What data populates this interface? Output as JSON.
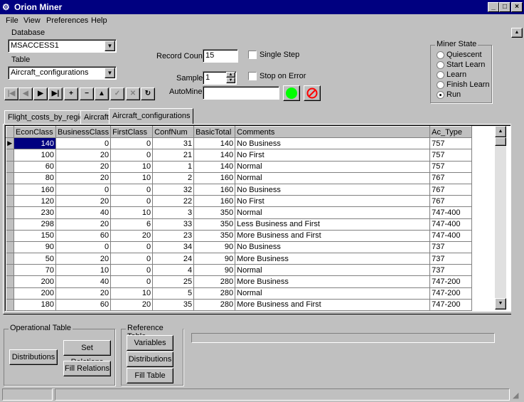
{
  "window": {
    "title": "Orion Miner"
  },
  "menu": [
    "File",
    "View",
    "Preferences",
    "Help"
  ],
  "database": {
    "label": "Database",
    "value": "MSACCESS1"
  },
  "table_select": {
    "label": "Table",
    "value": "Aircraft_configurations"
  },
  "record_count": {
    "label": "Record Count",
    "value": "15"
  },
  "sample": {
    "label": "Sample",
    "value": "1"
  },
  "automine": {
    "label": "AutoMine",
    "value": ""
  },
  "single_step": {
    "label": "Single Step",
    "checked": false
  },
  "stop_on_error": {
    "label": "Stop on Error",
    "checked": false
  },
  "status_colors": {
    "go": "#00ff00",
    "stop": "#ff0000"
  },
  "miner_state": {
    "title": "Miner State",
    "options": [
      "Quiescent",
      "Start Learn",
      "Learn",
      "Finish Learn",
      "Run"
    ],
    "selected": "Run"
  },
  "navigator_icons": [
    "first-record-icon",
    "prior-record-icon",
    "next-record-icon",
    "last-record-icon",
    "insert-record-icon",
    "delete-record-icon",
    "edit-record-icon",
    "post-edit-icon",
    "cancel-edit-icon",
    "refresh-icon"
  ],
  "tabs": [
    "Flight_costs_by_region",
    "Aircraft",
    "Aircraft_configurations"
  ],
  "active_tab": "Aircraft_configurations",
  "grid": {
    "columns": [
      "EconClass",
      "BusinessClass",
      "FirstClass",
      "ConfNum",
      "BasicTotal",
      "Comments",
      "Ac_Type"
    ],
    "rows": [
      [
        "140",
        "0",
        "0",
        "31",
        "140",
        "No Business",
        "757"
      ],
      [
        "100",
        "20",
        "0",
        "21",
        "140",
        "No First",
        "757"
      ],
      [
        "60",
        "20",
        "10",
        "1",
        "140",
        "Normal",
        "757"
      ],
      [
        "80",
        "20",
        "10",
        "2",
        "160",
        "Normal",
        "767"
      ],
      [
        "160",
        "0",
        "0",
        "32",
        "160",
        "No Business",
        "767"
      ],
      [
        "120",
        "20",
        "0",
        "22",
        "160",
        "No First",
        "767"
      ],
      [
        "230",
        "40",
        "10",
        "3",
        "350",
        "Normal",
        "747-400"
      ],
      [
        "298",
        "20",
        "6",
        "33",
        "350",
        "Less Business and First",
        "747-400"
      ],
      [
        "150",
        "60",
        "20",
        "23",
        "350",
        "More Business and First",
        "747-400"
      ],
      [
        "90",
        "0",
        "0",
        "34",
        "90",
        "No Business",
        "737"
      ],
      [
        "50",
        "20",
        "0",
        "24",
        "90",
        "More Business",
        "737"
      ],
      [
        "70",
        "10",
        "0",
        "4",
        "90",
        "Normal",
        "737"
      ],
      [
        "200",
        "40",
        "0",
        "25",
        "280",
        "More Business",
        "747-200"
      ],
      [
        "200",
        "20",
        "10",
        "5",
        "280",
        "Normal",
        "747-200"
      ],
      [
        "180",
        "60",
        "20",
        "35",
        "280",
        "More Business and First",
        "747-200"
      ]
    ]
  },
  "operational_table": {
    "title": "Operational Table",
    "distributions": "Distributions",
    "set_relations": "Set Relations",
    "fill_relations": "Fill Relations"
  },
  "reference_table": {
    "title": "Reference Table",
    "variables": "Variables",
    "distributions": "Distributions",
    "fill_table": "Fill Table"
  }
}
